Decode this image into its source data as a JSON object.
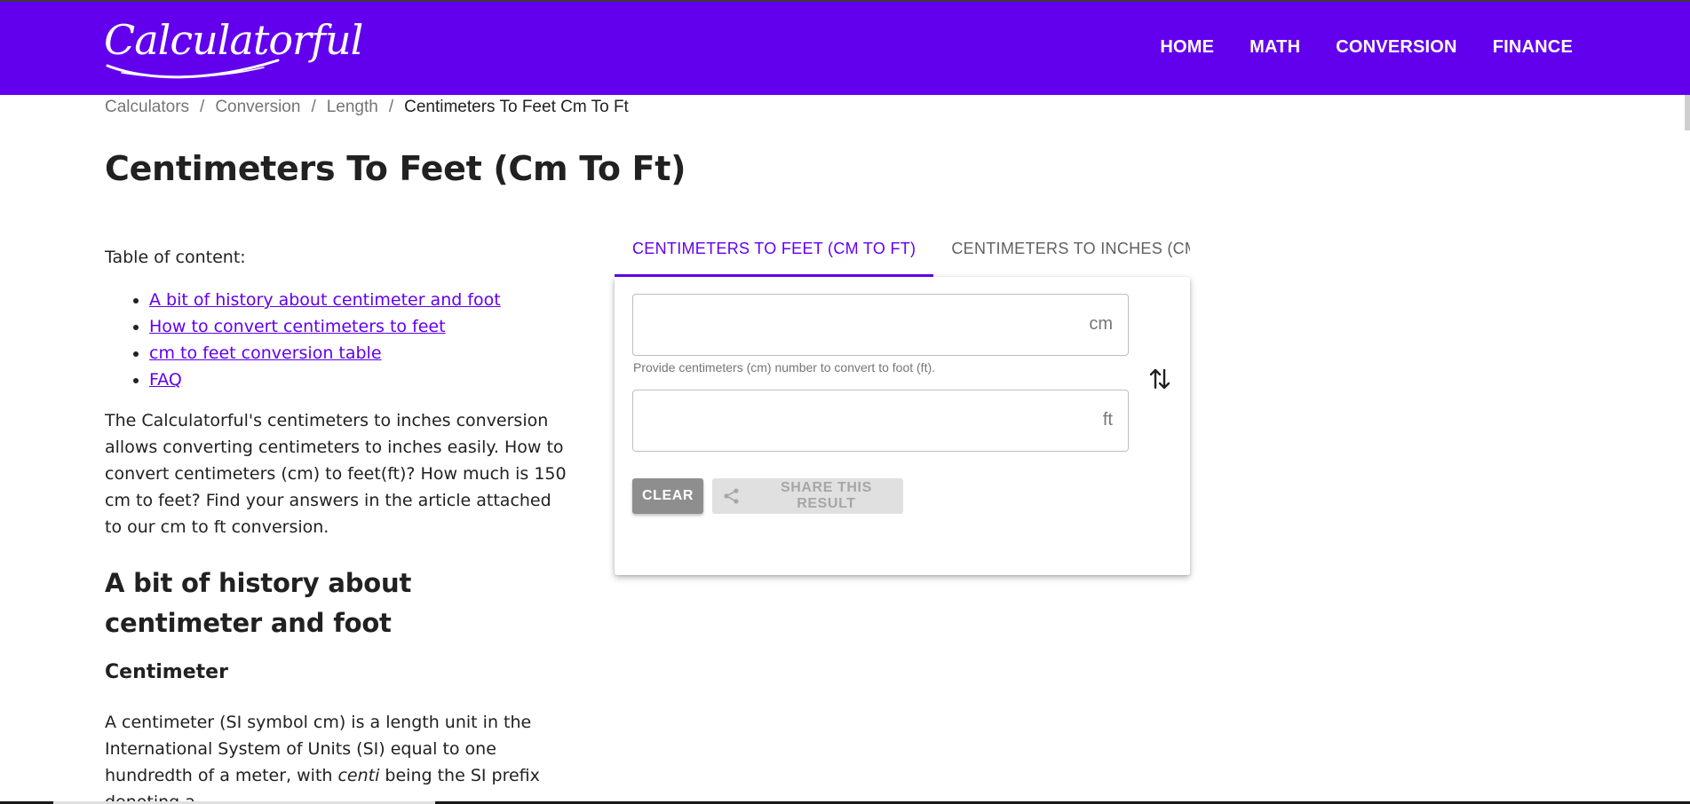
{
  "header": {
    "logo_text": "Calculatorful",
    "nav": [
      "HOME",
      "MATH",
      "CONVERSION",
      "FINANCE"
    ]
  },
  "breadcrumb": [
    "Calculators",
    "Conversion",
    "Length",
    "Centimeters To Feet Cm To Ft"
  ],
  "page_title": "Centimeters To Feet (Cm To Ft)",
  "toc": {
    "label": "Table of content:",
    "items": [
      "A bit of history about centimeter and foot",
      "How to convert centimeters to feet",
      "cm to feet conversion table",
      "FAQ"
    ]
  },
  "intro": "The Calculatorful's centimeters to inches conversion allows converting centimeters to inches easily. How to convert centimeters (cm) to feet(ft)? How much is 150 cm to feet? Find your answers in the article attached to our cm to ft conversion.",
  "section_heading": "A bit of history about centimeter and foot",
  "subheading": "Centimeter",
  "body": {
    "part1": "A centimeter (SI symbol cm) is a length unit in the International System of Units (SI) equal to one hundredth of a meter, with ",
    "em": "centi",
    "part2": " being the SI prefix denoting a"
  },
  "tabs": [
    "CENTIMETERS TO FEET (CM TO FT)",
    "CENTIMETERS TO INCHES (CM TO"
  ],
  "converter": {
    "input_unit": "cm",
    "input_value": "",
    "hint": "Provide centimeters (cm) number to convert to foot (ft).",
    "output_unit": "ft",
    "output_value": "",
    "clear_label": "CLEAR",
    "share_label": "SHARE THIS RESULT"
  },
  "colors": {
    "brand": "#6200ee",
    "text": "#212121",
    "muted": "#757575"
  }
}
